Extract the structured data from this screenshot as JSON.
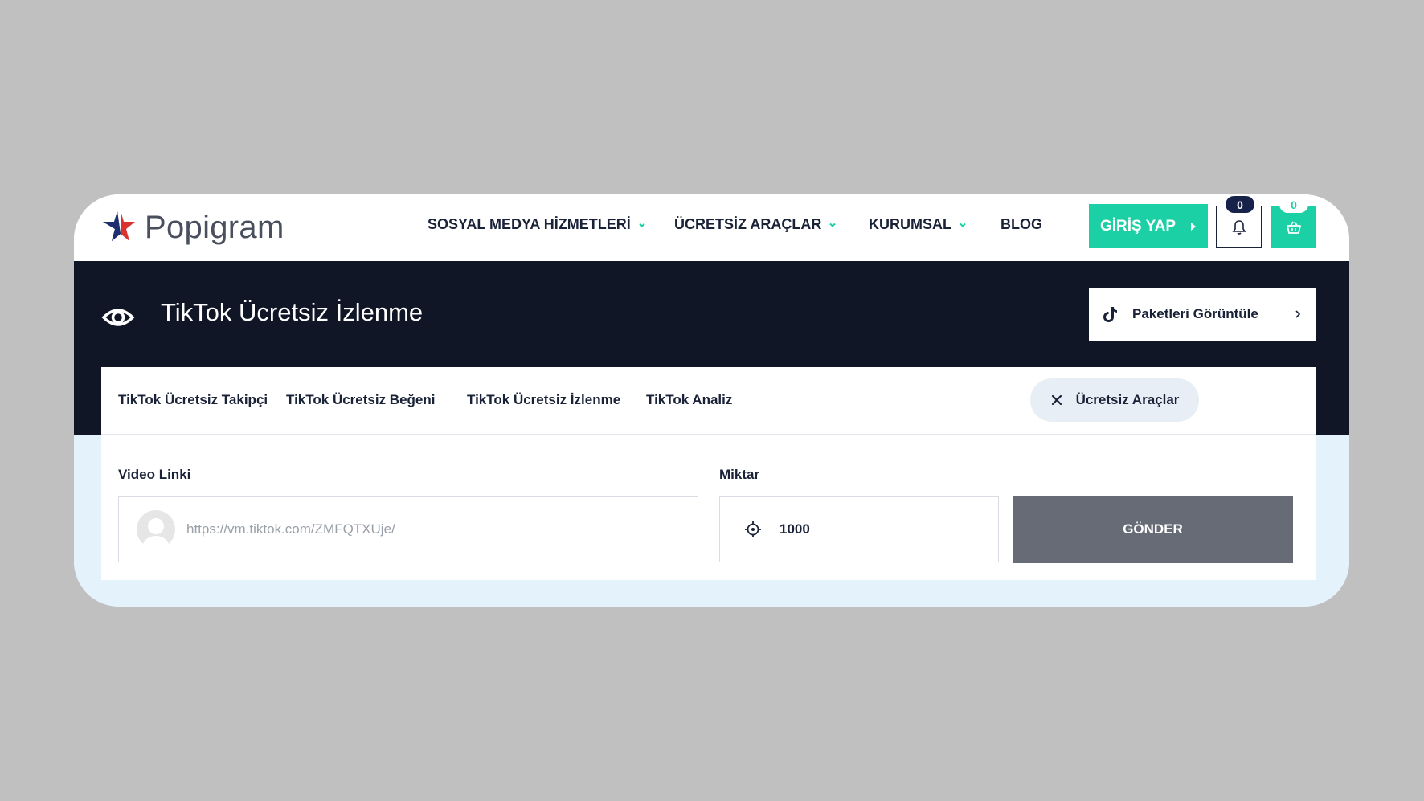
{
  "brand": {
    "name": "Popigram"
  },
  "nav": {
    "items": [
      {
        "label": "SOSYAL MEDYA HİZMETLERİ",
        "has_dropdown": true
      },
      {
        "label": "ÜCRETSİZ ARAÇLAR",
        "has_dropdown": true
      },
      {
        "label": "KURUMSAL",
        "has_dropdown": true
      },
      {
        "label": "BLOG",
        "has_dropdown": false
      }
    ],
    "login_label": "GİRİŞ YAP",
    "notification_count": "0",
    "cart_count": "0"
  },
  "page": {
    "title": "TikTok Ücretsiz İzlenme",
    "packages_label": "Paketleri Görüntüle"
  },
  "tabs": {
    "items": [
      {
        "label": "TikTok Ücretsiz Takipçi"
      },
      {
        "label": "TikTok Ücretsiz Beğeni"
      },
      {
        "label": "TikTok Ücretsiz İzlenme"
      },
      {
        "label": "TikTok Analiz"
      }
    ],
    "tools_label": "Ücretsiz Araçlar"
  },
  "form": {
    "video_link_label": "Video Linki",
    "video_link_placeholder": "https://vm.tiktok.com/ZMFQTXUje/",
    "amount_label": "Miktar",
    "amount_value": "1000",
    "submit_label": "GÖNDER"
  },
  "colors": {
    "accent": "#1ad0a4",
    "dark": "#111627",
    "text": "#1a2238",
    "submit": "#676b76",
    "page_bg": "#c0c0c0"
  }
}
